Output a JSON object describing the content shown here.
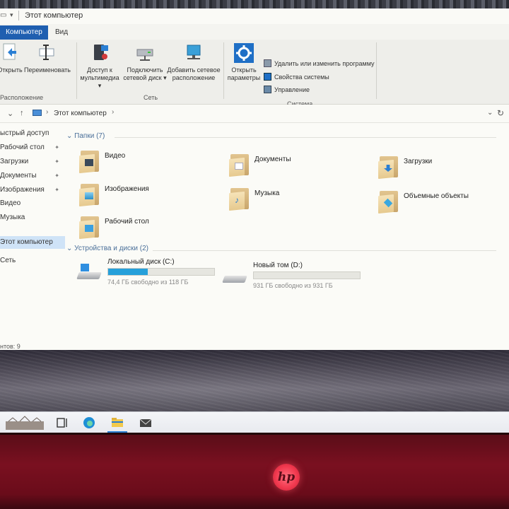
{
  "window": {
    "title": "Этот компьютер",
    "tabs": [
      "Компьютер",
      "Вид"
    ]
  },
  "ribbon": {
    "location": {
      "open_label": "Открыть",
      "rename_label": "Переименовать",
      "group_label": "Расположение"
    },
    "network": {
      "media_line1": "Доступ к",
      "media_line2": "мультимедиа",
      "map_drive_line1": "Подключить",
      "map_drive_line2": "сетевой диск",
      "add_location_line1": "Добавить сетевое",
      "add_location_line2": "расположение",
      "group_label": "Сеть"
    },
    "system": {
      "settings_line1": "Открыть",
      "settings_line2": "параметры",
      "uninstall_label": "Удалить или изменить программу",
      "properties_label": "Свойства системы",
      "manage_label": "Управление",
      "group_label": "Система"
    }
  },
  "address": {
    "path": "Этот компьютер"
  },
  "nav_pane": {
    "items": [
      {
        "label": "ыстрый доступ"
      },
      {
        "label": "Рабочий стол"
      },
      {
        "label": "Загрузки"
      },
      {
        "label": "Документы"
      },
      {
        "label": "Изображения"
      },
      {
        "label": "Видео"
      },
      {
        "label": "Музыка"
      },
      {
        "label": "Этот компьютер"
      },
      {
        "label": "Сеть"
      }
    ]
  },
  "content": {
    "folders_header": "Папки (7)",
    "folders": [
      "Видео",
      "Документы",
      "Загрузки",
      "Изображения",
      "Музыка",
      "Объемные объекты",
      "Рабочий стол"
    ],
    "drives_header": "Устройства и диски (2)",
    "drives": [
      {
        "name": "Локальный диск (C:)",
        "free": "74,4 ГБ свободно из 118 ГБ",
        "used_fraction": 0.37
      },
      {
        "name": "Новый том (D:)",
        "free": "931 ГБ свободно из 931 ГБ",
        "used_fraction": 0.0
      }
    ]
  },
  "status": {
    "items_count": "нтов: 9"
  },
  "colors": {
    "accent": "#1f5fb0",
    "selection": "#cfe3f7",
    "drive_fill": "#26a0da",
    "laptop_red": "#7a1020",
    "hp_logo": "#f23a50"
  },
  "brand": {
    "logo_text": "hp"
  }
}
